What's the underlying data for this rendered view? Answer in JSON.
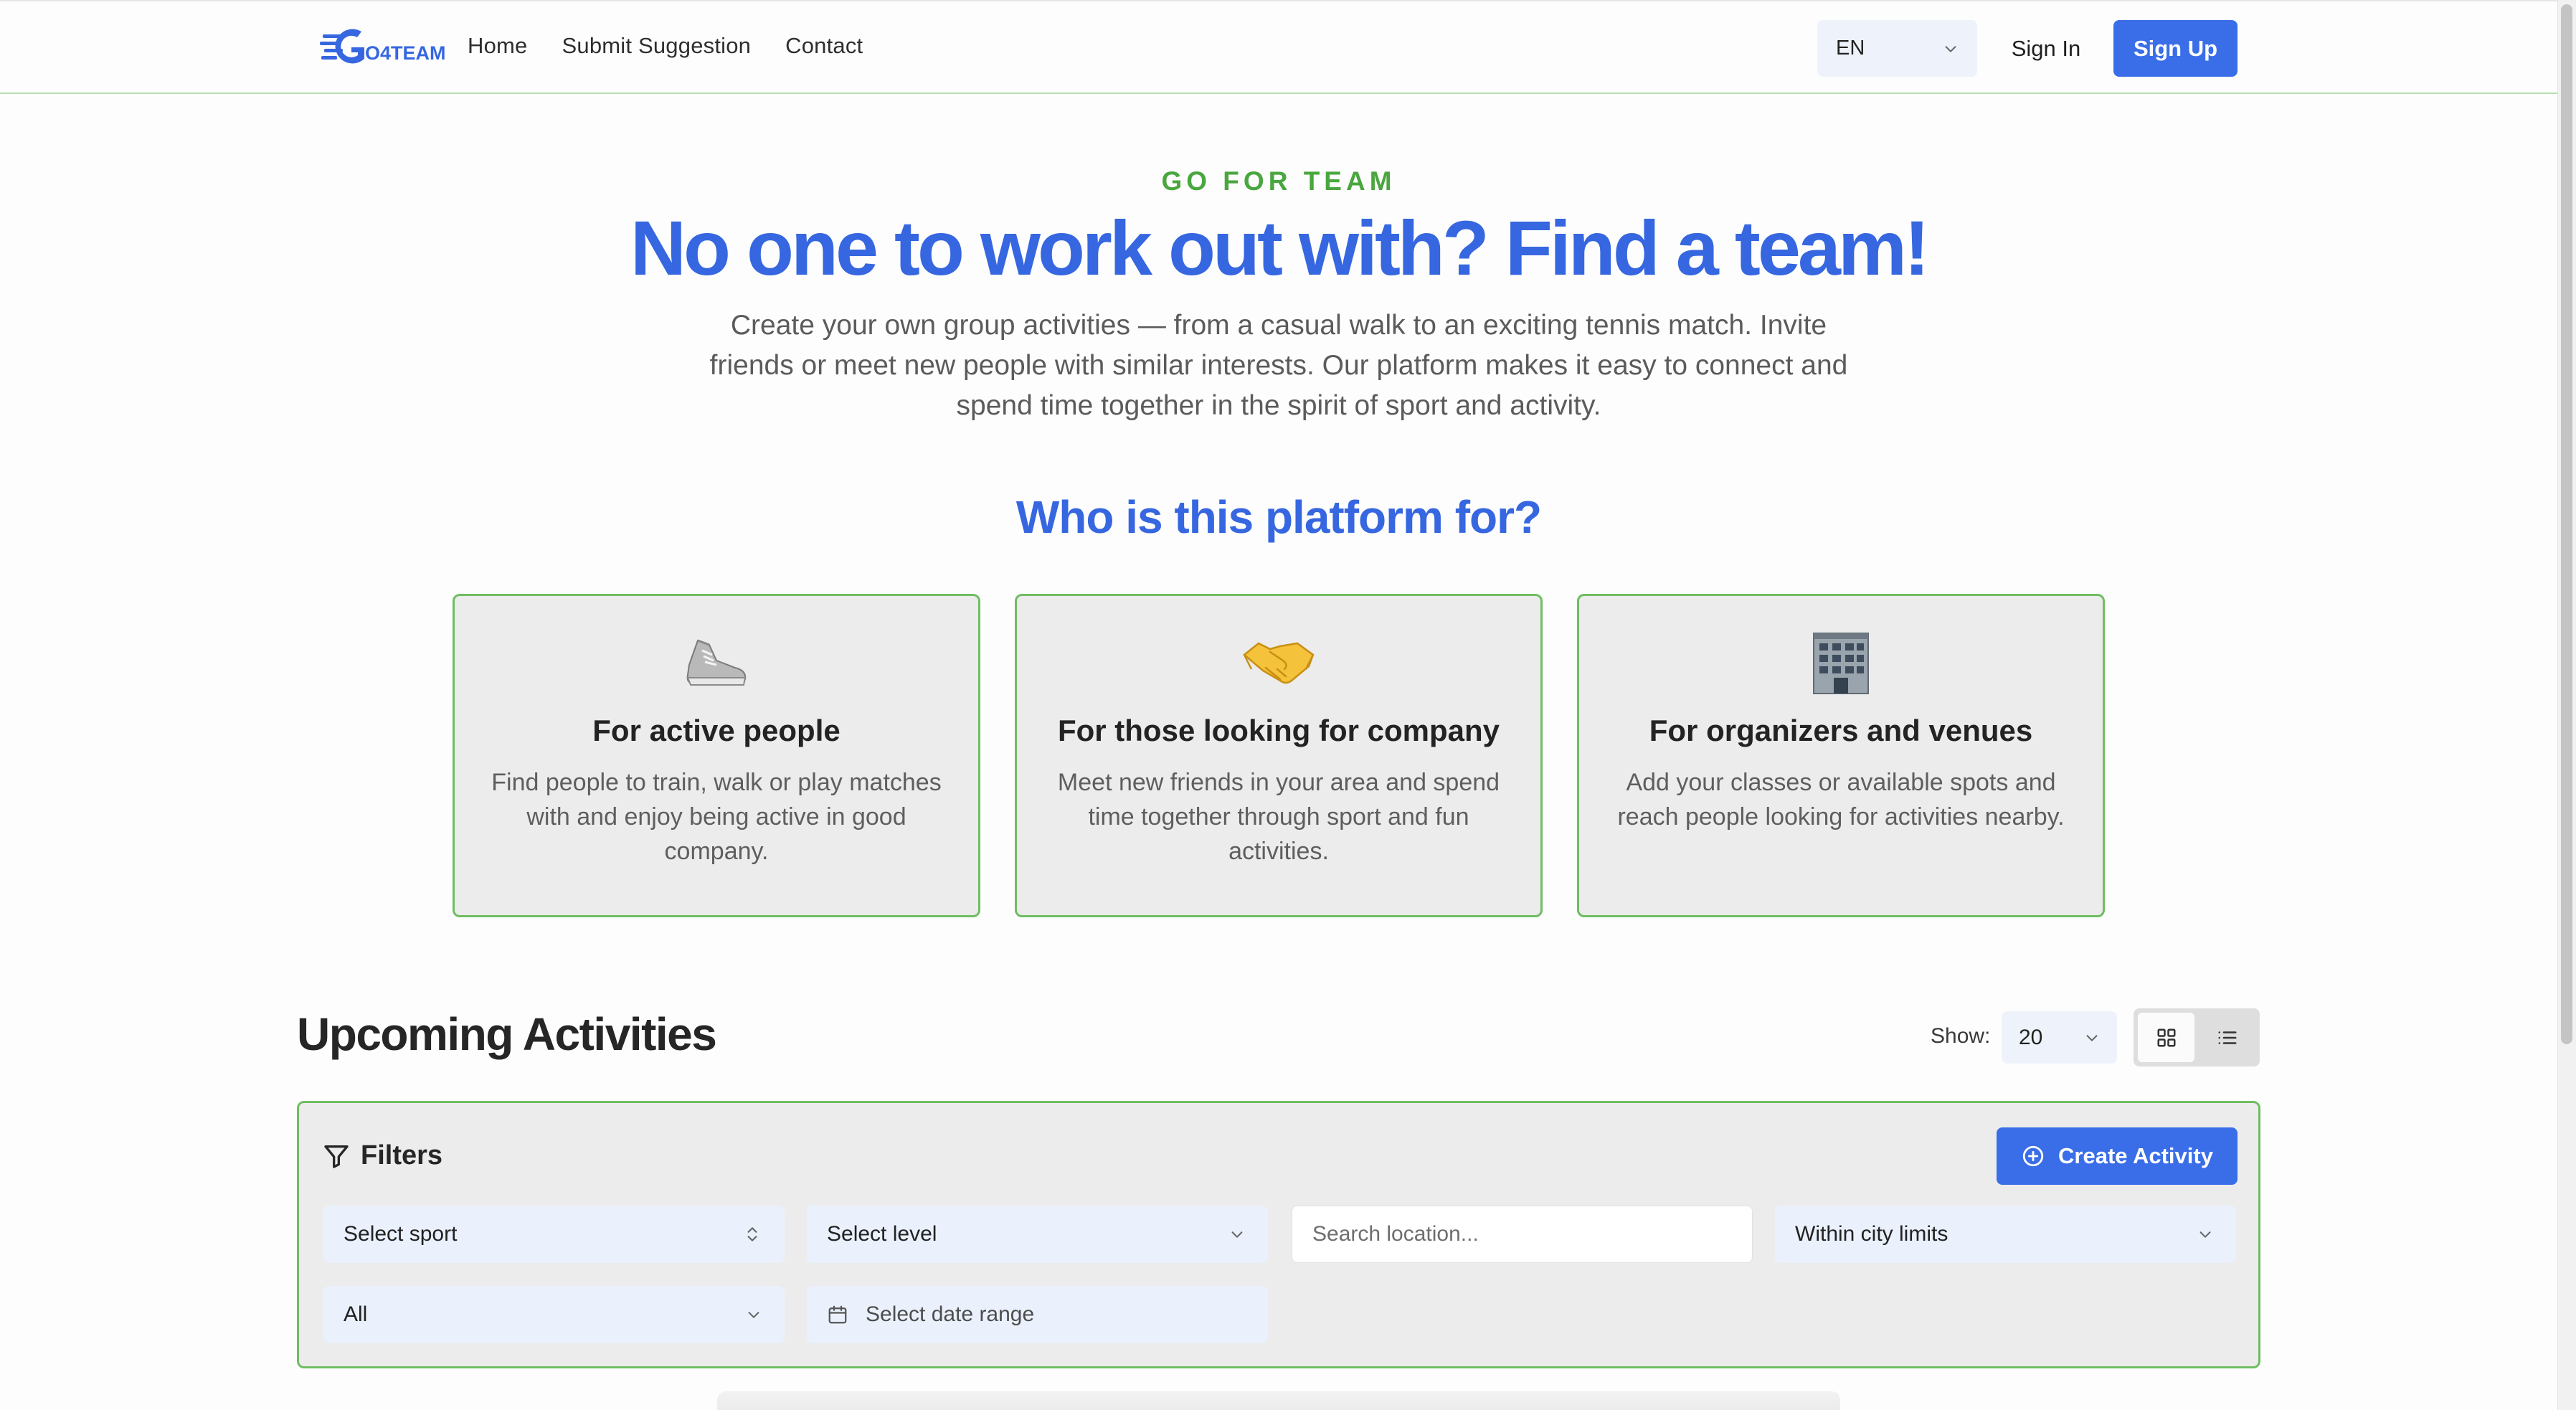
{
  "header": {
    "logo_text": "GO4TEAM",
    "nav": [
      {
        "label": "Home"
      },
      {
        "label": "Submit Suggestion"
      },
      {
        "label": "Contact"
      }
    ],
    "language": "EN",
    "sign_in": "Sign In",
    "sign_up": "Sign Up"
  },
  "hero": {
    "eyebrow": "GO FOR TEAM",
    "title": "No one to work out with? Find a team!",
    "description": "Create your own group activities — from a casual walk to an exciting tennis match. Invite friends or meet new people with similar interests. Our platform makes it easy to connect and spend time together in the spirit of sport and activity."
  },
  "audience": {
    "title": "Who is this platform for?",
    "cards": [
      {
        "icon": "sneaker-icon",
        "emoji": "👟",
        "title": "For active people",
        "text": "Find people to train, walk or play matches with and enjoy being active in good company."
      },
      {
        "icon": "handshake-icon",
        "emoji": "🤝",
        "title": "For those looking for company",
        "text": "Meet new friends in your area and spend time together through sport and fun activities."
      },
      {
        "icon": "building-icon",
        "emoji": "🏢",
        "title": "For organizers and venues",
        "text": "Add your classes or available spots and reach people looking for activities nearby."
      }
    ]
  },
  "upcoming": {
    "title": "Upcoming Activities",
    "show_label": "Show:",
    "show_value": "20",
    "view_mode": "grid"
  },
  "filters": {
    "title": "Filters",
    "create_button": "Create Activity",
    "sport_placeholder": "Select sport",
    "level_placeholder": "Select level",
    "location_placeholder": "Search location...",
    "distance_value": "Within city limits",
    "all_value": "All",
    "date_placeholder": "Select date range"
  },
  "colors": {
    "brand_blue": "#3a6ee8",
    "accent_green": "#4aa63e",
    "card_border": "#6fbe62"
  }
}
